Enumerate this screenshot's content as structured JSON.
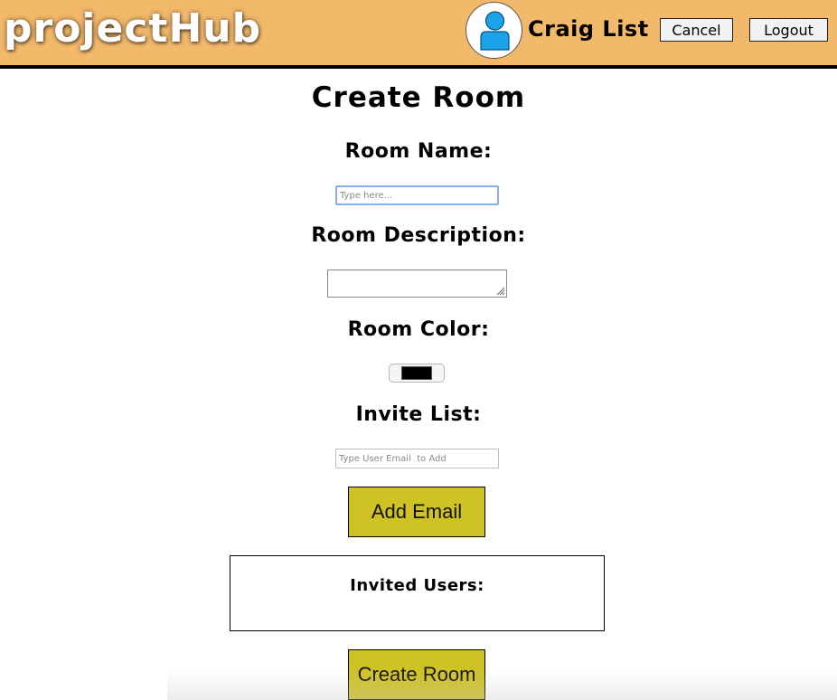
{
  "header": {
    "logo": "projectHub",
    "user_name": "Craig List",
    "cancel_label": "Cancel",
    "logout_label": "Logout",
    "background_color": "#f3b96b"
  },
  "form": {
    "title": "Create Room",
    "room_name_label": "Room Name:",
    "room_name_value": "",
    "room_name_placeholder": "Type here...",
    "room_description_label": "Room Description:",
    "room_description_value": "",
    "room_color_label": "Room Color:",
    "room_color_value": "#000000",
    "invite_list_label": "Invite List:",
    "invite_placeholder": "Type User Email  to Add",
    "add_email_label": "Add Email",
    "invited_users_title": "Invited Users:",
    "create_room_label": "Create Room",
    "button_color": "#cfc224"
  },
  "icons": {
    "avatar": "user-avatar-icon",
    "resize": "resize-grip-icon"
  }
}
